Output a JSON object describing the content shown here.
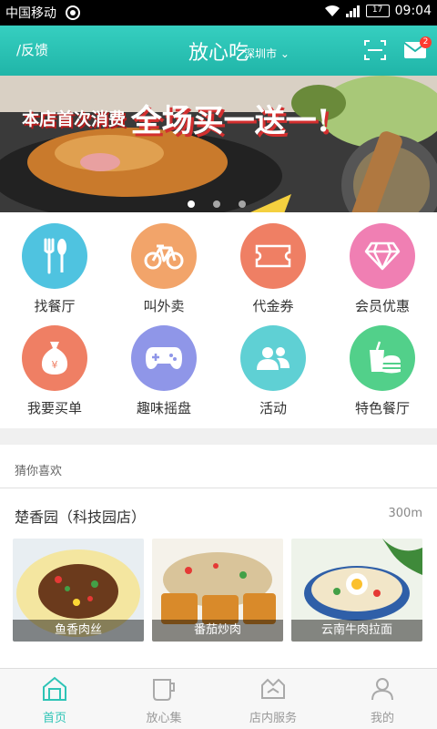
{
  "status": {
    "carrier": "中国移动",
    "battery": "17",
    "time": "09:04"
  },
  "header": {
    "feedback": "/反馈",
    "title": "放心吃",
    "city": "深圳市",
    "mail_badge": "2"
  },
  "banner": {
    "text_small": "本店首次消费",
    "text_big": "全场买一送一!"
  },
  "grid": [
    {
      "label": "找餐厅",
      "icon": "fork-knife-icon",
      "color": "#4fc3e0"
    },
    {
      "label": "叫外卖",
      "icon": "bicycle-icon",
      "color": "#f2a46a"
    },
    {
      "label": "代金券",
      "icon": "coupon-icon",
      "color": "#ef7f64"
    },
    {
      "label": "会员优惠",
      "icon": "diamond-icon",
      "color": "#f07fb3"
    },
    {
      "label": "我要买单",
      "icon": "money-bag-icon",
      "color": "#ef7f64"
    },
    {
      "label": "趣味摇盘",
      "icon": "gamepad-icon",
      "color": "#8f96e8"
    },
    {
      "label": "活动",
      "icon": "people-icon",
      "color": "#5fd0d4"
    },
    {
      "label": "特色餐厅",
      "icon": "fast-food-icon",
      "color": "#52d08a"
    }
  ],
  "reco": {
    "section_title": "猜你喜欢",
    "shop_name": "楚香园（科技园店）",
    "distance": "300m",
    "dishes": [
      {
        "name": "鱼香肉丝"
      },
      {
        "name": "番茄炒肉"
      },
      {
        "name": "云南牛肉拉面"
      }
    ]
  },
  "tabs": [
    {
      "label": "首页"
    },
    {
      "label": "放心集"
    },
    {
      "label": "店内服务"
    },
    {
      "label": "我的"
    }
  ]
}
